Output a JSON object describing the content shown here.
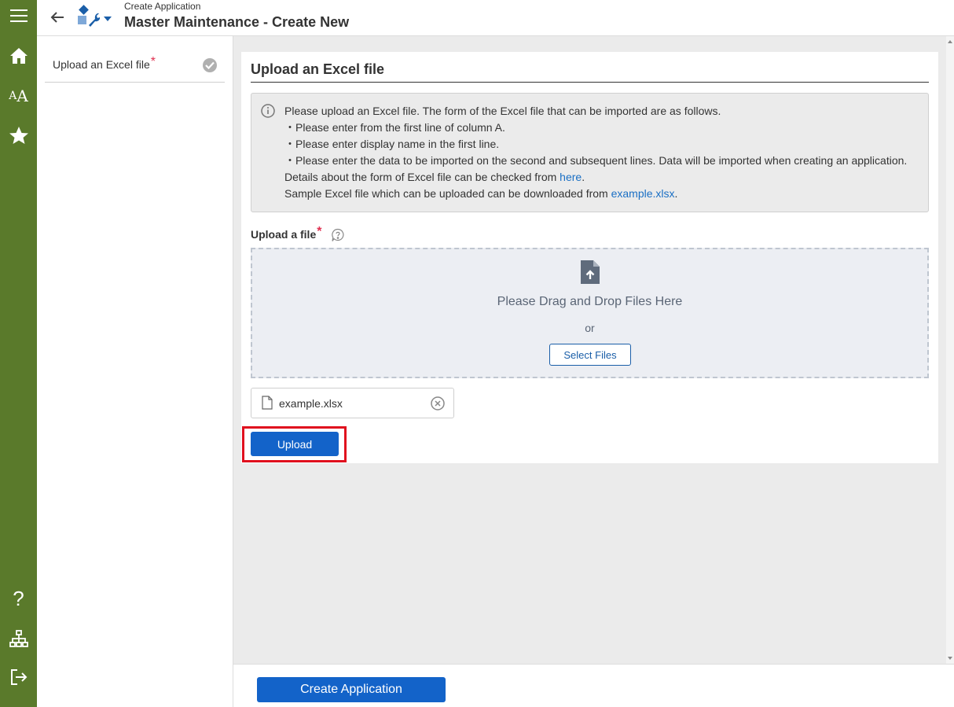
{
  "header": {
    "breadcrumb": "Create Application",
    "title": "Master Maintenance - Create New"
  },
  "rail": {
    "icons": [
      "menu-icon",
      "home-icon",
      "font-size-icon",
      "star-icon",
      "help-icon",
      "sitemap-icon",
      "logout-icon"
    ],
    "help_glyph": "?"
  },
  "steps": [
    {
      "label": "Upload an Excel file",
      "required_mark": "*",
      "completed": true
    }
  ],
  "panel": {
    "title": "Upload an Excel file",
    "info": {
      "line1": "Please upload an Excel file. The form of the Excel file that can be imported are as follows.",
      "line2": "・Please enter from the first line of column A.",
      "line3": "・Please enter display name in the first line.",
      "line4": "・Please enter the data to be imported on the second and subsequent lines. Data will be imported when creating an application.",
      "line5_prefix": "Details about the form of Excel file can be checked from ",
      "line5_link": "here",
      "line5_suffix": ".",
      "line6_prefix": "Sample Excel file which can be uploaded can be downloaded from ",
      "line6_link": "example.xlsx",
      "line6_suffix": "."
    },
    "upload_field": {
      "label": "Upload a file",
      "required_mark": "*",
      "drop_text": "Please Drag and Drop Files Here",
      "or_text": "or",
      "select_label": "Select Files"
    },
    "file": {
      "name": "example.xlsx"
    },
    "upload_label": "Upload"
  },
  "footer": {
    "create_label": "Create Application"
  },
  "colors": {
    "rail": "#5a7a2b",
    "primary": "#1363c9",
    "link": "#1a6fc4",
    "required": "#e03050",
    "highlight": "#e0101e"
  }
}
